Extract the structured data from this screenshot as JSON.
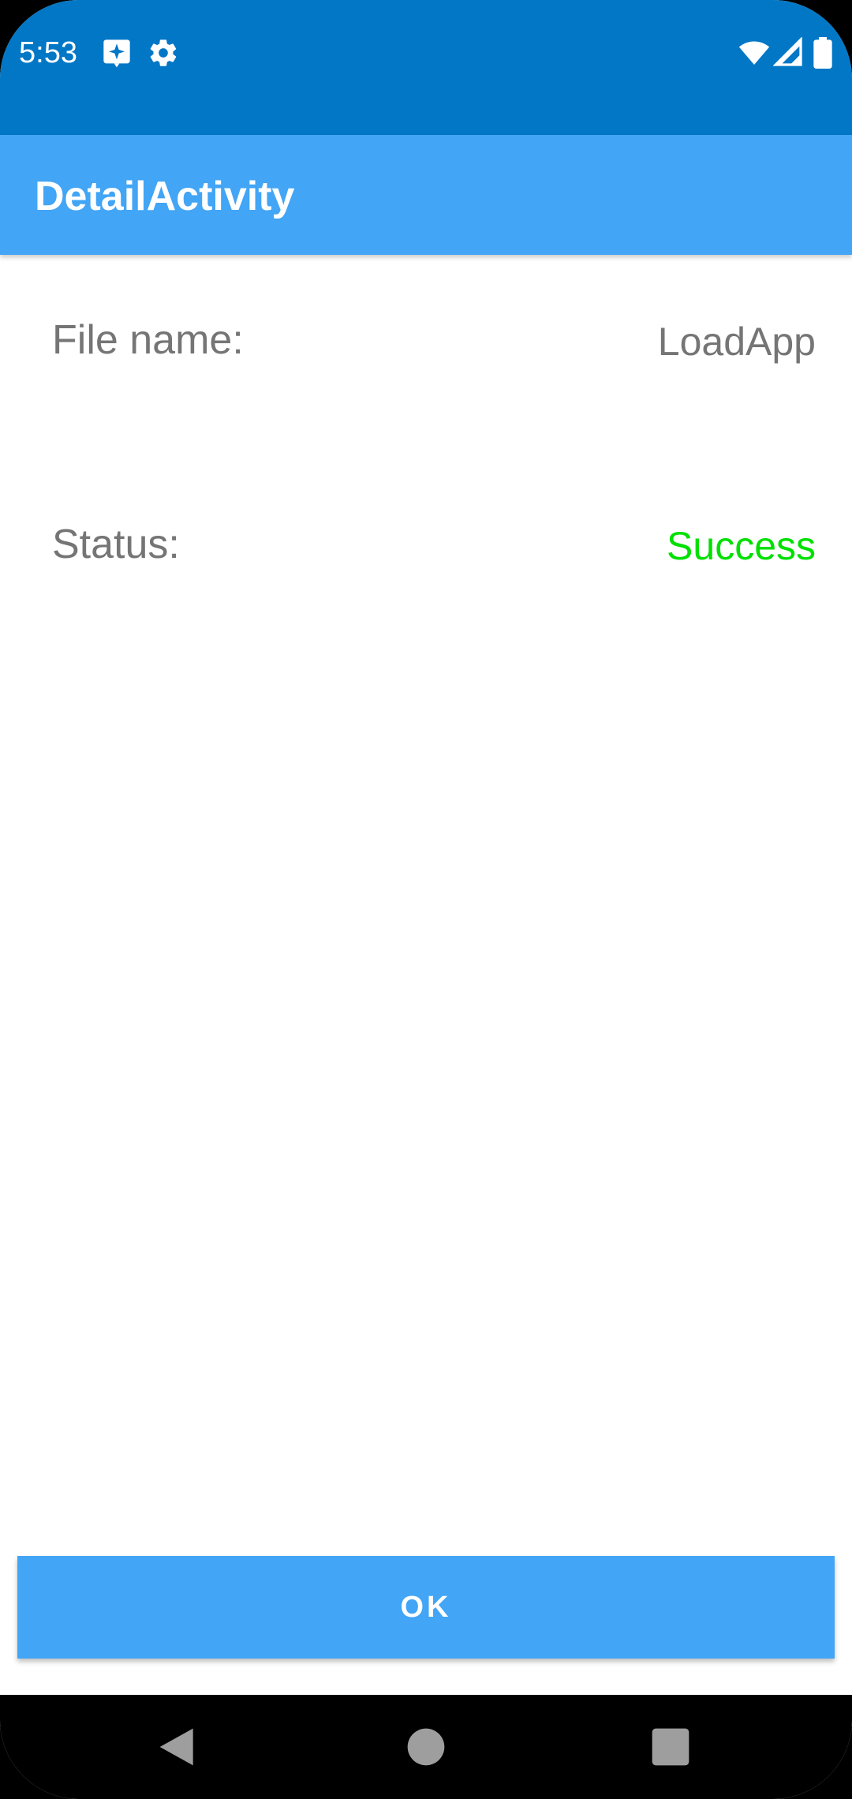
{
  "status_bar": {
    "time": "5:53",
    "background_color": "#0277C6",
    "icons": [
      "notification-icon",
      "settings-icon",
      "wifi-icon",
      "signal-icon",
      "battery-icon"
    ]
  },
  "app_bar": {
    "title": "DetailActivity",
    "background_color": "#42A5F5"
  },
  "details": {
    "file_name_label": "File name:",
    "file_name_value": "LoadApp",
    "status_label": "Status:",
    "status_value": "Success",
    "status_color": "#00E000"
  },
  "actions": {
    "ok_label": "OK"
  },
  "nav_bar": {
    "icons": [
      "back-icon",
      "home-icon",
      "recents-icon"
    ]
  }
}
